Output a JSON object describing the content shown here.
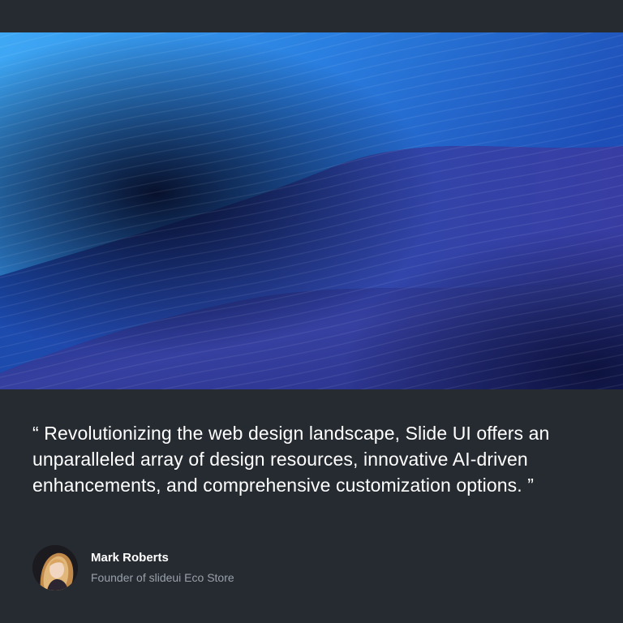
{
  "hero": {
    "image": "abstract-blue-wave-texture"
  },
  "testimonial": {
    "quote": "“ Revolutionizing the web design landscape, Slide UI offers an unparalleled array of design resources, innovative AI-driven enhancements, and comprehensive customization options. ”"
  },
  "author": {
    "name": "Mark Roberts",
    "role": "Founder of slideui Eco Store",
    "avatar": "woman-portrait-avatar"
  },
  "colors": {
    "background": "#262b31",
    "text_primary": "#ffffff",
    "text_secondary": "#9aa1aa",
    "accent_blue": "#2f8fe6",
    "deep_blue": "#0b1330"
  }
}
